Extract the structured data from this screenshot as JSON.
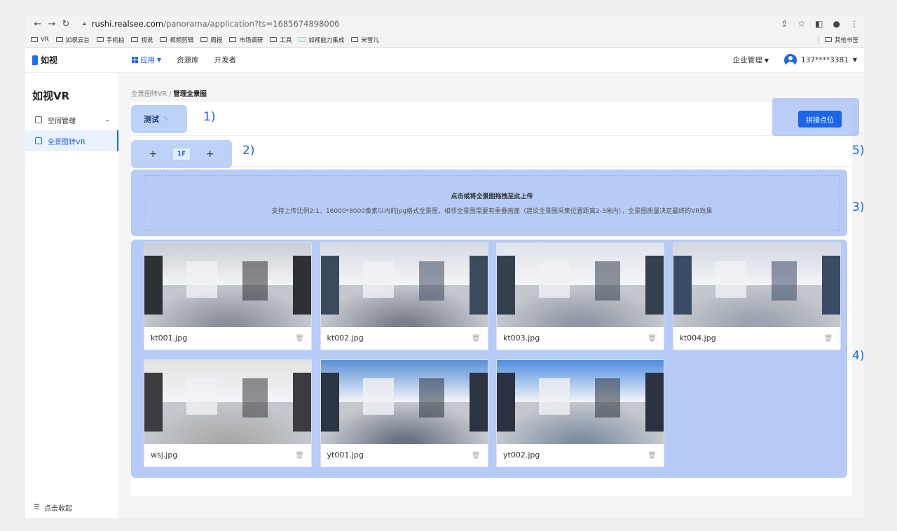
{
  "browser": {
    "url_host": "rushi.realsee.com",
    "url_path": "/panorama/application?ts=1685674898006",
    "bookmarks": [
      "VR",
      "如视云台",
      "手机拍",
      "视说",
      "视频剪辑",
      "周报",
      "市场调研",
      "工具",
      "如视能力集成",
      "米雪儿"
    ],
    "other_bookmarks": "其他书签"
  },
  "header": {
    "logo": "如视",
    "nav": [
      {
        "label": "应用"
      },
      {
        "label": "资源库"
      },
      {
        "label": "开发者"
      }
    ],
    "org_menu": "企业管理",
    "user_phone": "137****3381"
  },
  "sidebar": {
    "title": "如视VR",
    "items": [
      {
        "label": "空间管理"
      },
      {
        "label": "全景图转VR"
      }
    ],
    "collapse": "点击收起"
  },
  "breadcrumb": {
    "parent": "全景图转VR",
    "separator": "/",
    "current": "管理全景图"
  },
  "project": {
    "name": "测试",
    "stitch_button": "拼接点位"
  },
  "floors": {
    "current": "1F"
  },
  "upload": {
    "title": "点击或将全景图拖拽至此上传",
    "desc": "支持上传比例2:1，16000*8000像素以内的jpg格式全景图，相邻全景图需要有重叠画面（建议全景图采集位置距离2-3米内），全景图质量决定最终的VR效果"
  },
  "images": [
    {
      "name": "kt001.jpg"
    },
    {
      "name": "kt002.jpg"
    },
    {
      "name": "kt003.jpg"
    },
    {
      "name": "kt004.jpg"
    },
    {
      "name": "wsj.jpg"
    },
    {
      "name": "yt001.jpg"
    },
    {
      "name": "yt002.jpg"
    }
  ],
  "markers": [
    "1)",
    "2)",
    "3)",
    "4)",
    "5)"
  ],
  "colors": {
    "accent": "#1a66e8",
    "highlight": "#b6cbf5"
  }
}
